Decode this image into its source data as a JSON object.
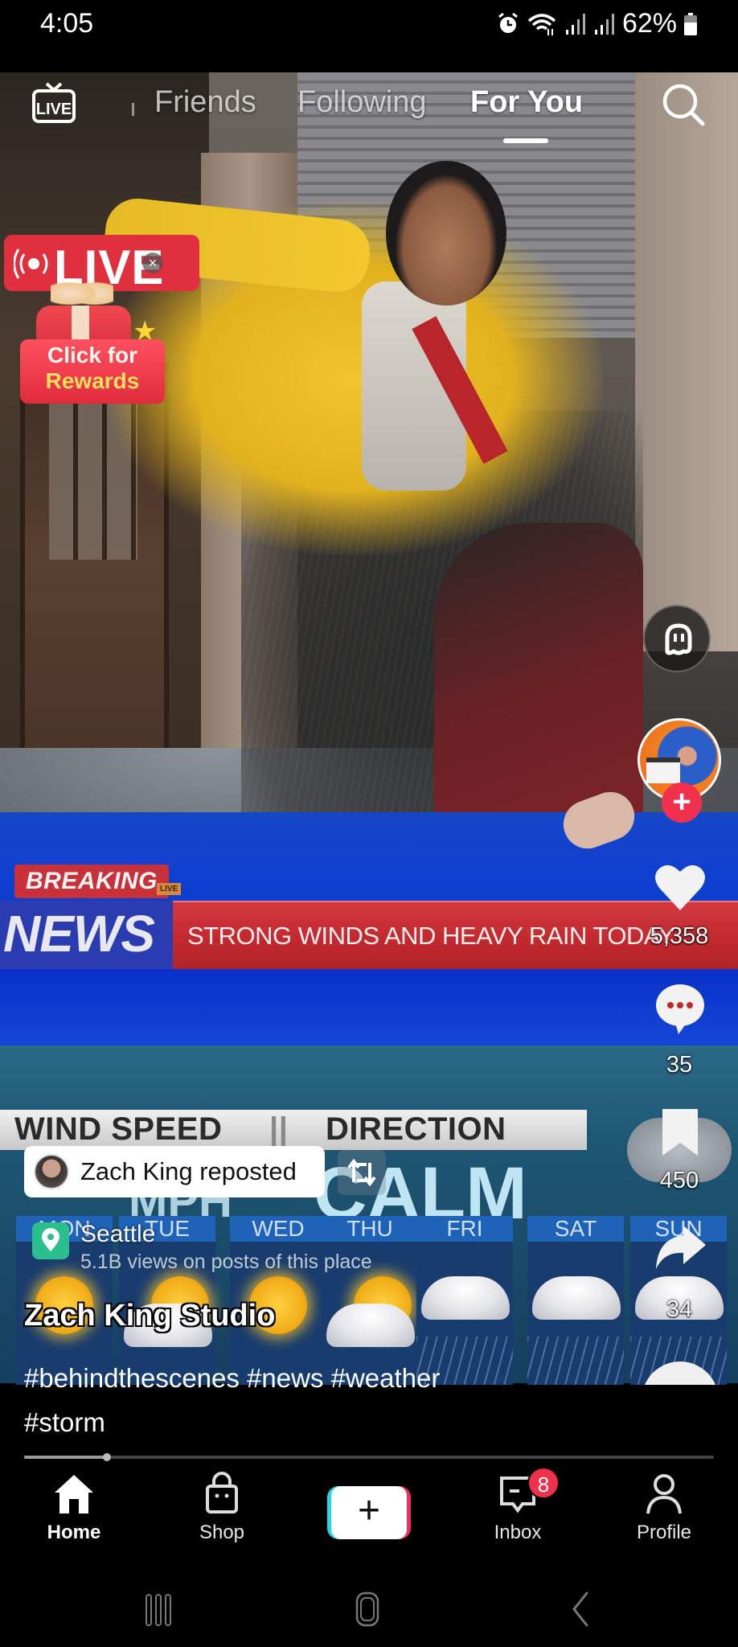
{
  "status_bar": {
    "time": "4:05",
    "battery": "62%",
    "icons": [
      "alarm-icon",
      "wifi-icon",
      "signal-icon",
      "signal-icon",
      "battery-icon"
    ]
  },
  "top_nav": {
    "live_label": "LIVE",
    "tabs": [
      {
        "label": "Friends",
        "active": false
      },
      {
        "label": "Following",
        "active": false
      },
      {
        "label": "For You",
        "active": true
      }
    ],
    "search_icon": "search-icon"
  },
  "live_promo": {
    "badge": "LIVE",
    "close": "×",
    "cta_line1": "Click for",
    "cta_line2": "Rewards"
  },
  "video_overlay_text": {
    "breaking": "BREAKING",
    "live_mini": "LIVE",
    "news": "NEWS",
    "ticker": "STRONG WINDS AND HEAVY RAIN TODAY",
    "wind_speed": "WIND SPEED",
    "direction": "DIRECTION",
    "mph": "MPH",
    "calm": "CALM",
    "days": [
      {
        "label": "MON",
        "weather": "sunny"
      },
      {
        "label": "TUE",
        "weather": "partly-cloudy"
      },
      {
        "label": "WED",
        "weather": "sunny"
      },
      {
        "label": "THU",
        "weather": "partly-cloudy"
      },
      {
        "label": "FRI",
        "weather": "rain"
      },
      {
        "label": "SAT",
        "weather": "storm"
      },
      {
        "label": "SUN",
        "weather": "storm"
      }
    ]
  },
  "actions": {
    "likes": "5,358",
    "comments": "35",
    "saves": "450",
    "shares": "34",
    "follow": "+"
  },
  "post": {
    "repost_label": "Zach King reposted",
    "location_name": "Seattle",
    "location_views": "5.1B views on posts of this place",
    "author": "Zach King Studio",
    "caption_line1": "#behindthescenes #news #weather",
    "caption_line2": "#storm",
    "progress": 0.12
  },
  "bottom_nav": {
    "items": [
      {
        "label": "Home",
        "icon": "home-icon",
        "active": true
      },
      {
        "label": "Shop",
        "icon": "shop-bag-icon",
        "active": false
      },
      {
        "label": "",
        "icon": "create-plus-icon",
        "active": false
      },
      {
        "label": "Inbox",
        "icon": "inbox-icon",
        "active": false,
        "badge": "8"
      },
      {
        "label": "Profile",
        "icon": "profile-icon",
        "active": false
      }
    ],
    "create_symbol": "+"
  },
  "colors": {
    "accent_red": "#f0304c",
    "accent_cyan": "#22d7e6",
    "location_green": "#2bbf8e"
  }
}
